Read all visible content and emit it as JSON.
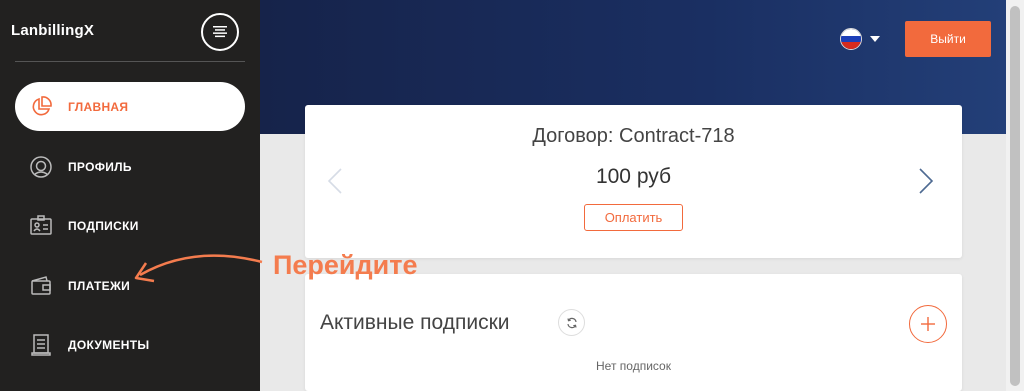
{
  "sidebar": {
    "brand": "LanbillingX",
    "items": [
      {
        "label": "ГЛАВНАЯ",
        "icon": "pie-chart-icon",
        "active": true
      },
      {
        "label": "ПРОФИЛЬ",
        "icon": "user-circle-icon",
        "active": false
      },
      {
        "label": "ПОДПИСКИ",
        "icon": "id-card-icon",
        "active": false
      },
      {
        "label": "ПЛАТЕЖИ",
        "icon": "wallet-icon",
        "active": false
      },
      {
        "label": "ДОКУМЕНТЫ",
        "icon": "document-icon",
        "active": false
      }
    ]
  },
  "header": {
    "language_icon": "russian-flag-icon",
    "logout_label": "Выйти"
  },
  "contract": {
    "title": "Договор: Contract-718",
    "amount": "100 руб",
    "pay_label": "Оплатить"
  },
  "subscriptions": {
    "title": "Активные подписки",
    "empty_text": "Нет подписок"
  },
  "annotation": {
    "text": "Перейдите"
  },
  "colors": {
    "accent": "#f26a3d",
    "sidebar_bg": "#222120",
    "header_bg": "#1a2f62",
    "annotation": "#f47c4e"
  }
}
